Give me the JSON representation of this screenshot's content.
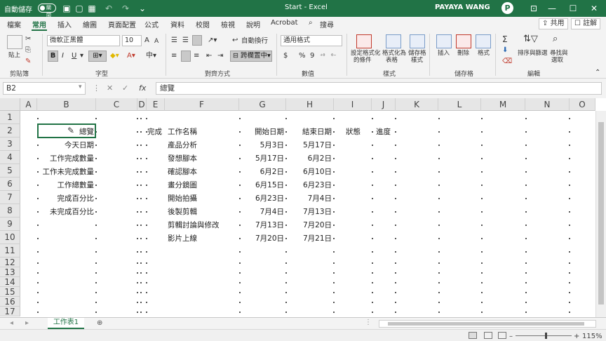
{
  "app": {
    "title": "Start - Excel",
    "autosave_label": "自動儲存",
    "autosave_state": "關閉",
    "user_name": "PAYAYA WANG",
    "user_initial": "P",
    "accent": "#217346"
  },
  "window_buttons": {
    "minimize": "—",
    "maximize": "☐",
    "close": "✕"
  },
  "qat": {
    "save": "▣",
    "undo": "↶",
    "redo": "↷"
  },
  "tabs": [
    "檔案",
    "常用",
    "插入",
    "繪圖",
    "頁面配置",
    "公式",
    "資料",
    "校閱",
    "檢視",
    "說明",
    "Acrobat",
    "搜尋"
  ],
  "active_tab": "常用",
  "share_label": "共用",
  "comment_label": "註解",
  "ribbon": {
    "groups": [
      "剪貼簿",
      "字型",
      "對齊方式",
      "數值",
      "樣式",
      "儲存格",
      "編輯"
    ],
    "paste_label": "貼上",
    "font_name": "微軟正黑體",
    "font_size": "10",
    "bold": "B",
    "italic": "I",
    "underline": "U",
    "increase_font": "A",
    "decrease_font": "A",
    "wrap_text": "自動換行",
    "merge_center": "跨欄置中",
    "number_format": "通用格式",
    "currency": "$",
    "percent": "%",
    "comma": "9",
    "cond_format": [
      "設定格式化",
      "的條件"
    ],
    "format_table": [
      "格式化為",
      "表格"
    ],
    "cell_styles": [
      "儲存格",
      "樣式"
    ],
    "insert": "插入",
    "delete": "刪除",
    "format": "格式",
    "sum_sym": "Σ",
    "sort_filter": [
      "排序與篩選"
    ],
    "find_select": [
      "尋找與",
      "選取"
    ]
  },
  "formula_bar": {
    "name_box": "B2",
    "fx": "fx",
    "formula": "總覽"
  },
  "columns": [
    "A",
    "B",
    "C",
    "D",
    "E",
    "F",
    "G",
    "H",
    "I",
    "J",
    "K",
    "L",
    "M",
    "N",
    "O"
  ],
  "rows": [
    "1",
    "2",
    "3",
    "4",
    "5",
    "6",
    "7",
    "8",
    "9",
    "10",
    "11",
    "12",
    "13",
    "14",
    "15",
    "16",
    "17"
  ],
  "cells": {
    "B": [
      "總覽",
      "今天日期",
      "工作完成數量",
      "工作未完成數量",
      "工作總數量",
      "完成百分比",
      "未完成百分比"
    ],
    "E2": "完成",
    "F": [
      "工作名稱",
      "產品分析",
      "發想腳本",
      "確認腳本",
      "畫分鏡圖",
      "開始拍攝",
      "後製剪輯",
      "剪輯討論與修改",
      "影片上線"
    ],
    "G": [
      "開始日期",
      "5月3日",
      "5月17日",
      "6月2日",
      "6月15日",
      "6月23日",
      "7月4日",
      "7月13日",
      "7月20日"
    ],
    "H": [
      "結束日期",
      "5月17日",
      "6月2日",
      "6月10日",
      "6月23日",
      "7月4日",
      "7月13日",
      "7月20日",
      "7月21日"
    ],
    "I2": "狀態",
    "J2": "進度"
  },
  "sheet_tab": "工作表1",
  "add_sheet": "⊕",
  "zoom": "115%"
}
